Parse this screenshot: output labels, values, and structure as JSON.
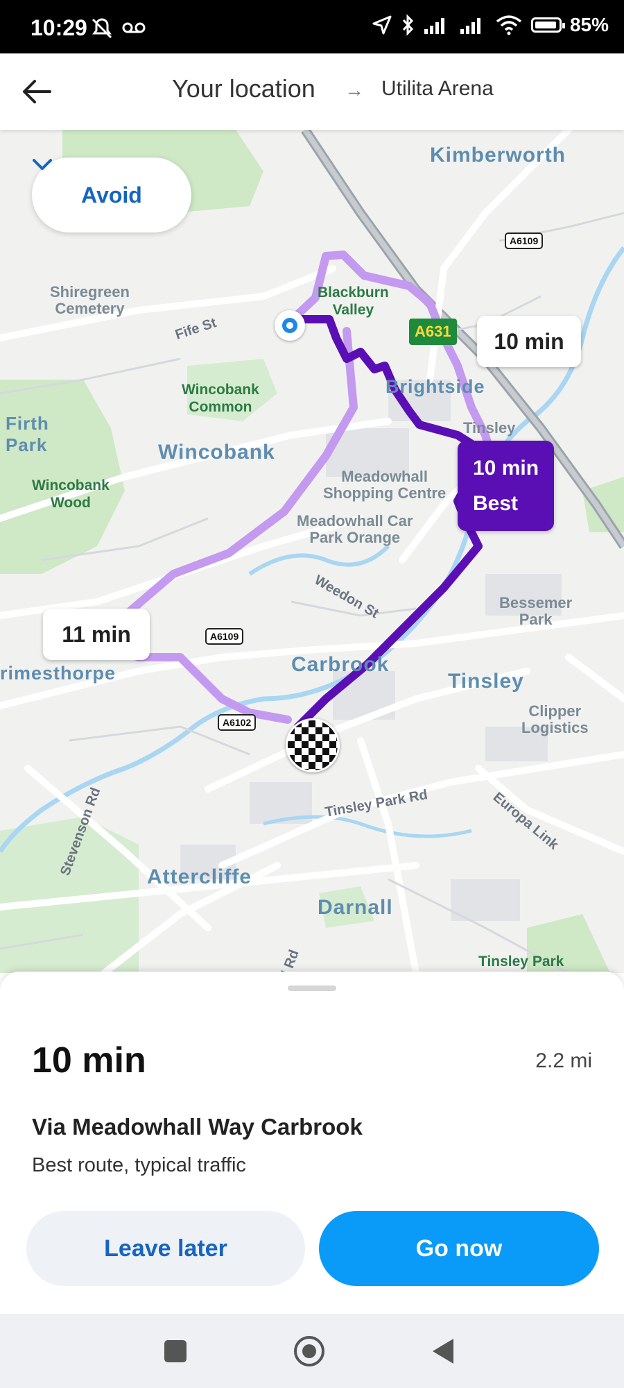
{
  "status_bar": {
    "time": "10:29",
    "battery": "85%",
    "battery_level": 0.85
  },
  "header": {
    "from": "Your location",
    "arrow": "→",
    "to": "Utilita Arena"
  },
  "map": {
    "avoid_label": "Avoid",
    "labels": {
      "kimberworth": "Kimberworth",
      "shiregreen": "Shiregreen\nCemetery",
      "blackburn": "Blackburn\nValley",
      "fife": "Fife St",
      "brightside": "Brightside",
      "wincobank_common": "Wincobank\nCommon",
      "firth_park": "Firth\nPark",
      "wincobank": "Wincobank",
      "wincobank_wood": "Wincobank\nWood",
      "meadowhall": "Meadowhall\nShopping Centre",
      "meadowhall_car": "Meadowhall Car\nPark Orange",
      "tinsley_small": "Tinsley",
      "weedon": "Weedon St",
      "bessemer": "Bessemer\nPark",
      "brimesthorpe": "rimesthorpe",
      "carbrook": "Carbrook",
      "tinsley": "Tinsley",
      "clipper": "Clipper\nLogistics",
      "tinsley_park_rd": "Tinsley Park Rd",
      "europa": "Europa Link",
      "stevenson": "Stevenson Rd",
      "attercliffe": "Attercliffe",
      "darnall": "Darnall",
      "tinsley_park": "Tinsley Park",
      "rd": "d Rd"
    },
    "shields": {
      "a6109_top": "A6109",
      "a631": "A631",
      "a6109_mid": "A6109",
      "a6102": "A6102"
    },
    "routes": {
      "alt_east": "10 min",
      "best_time": "10 min",
      "best_tag": "Best",
      "alt_west": "11 min"
    }
  },
  "summary": {
    "eta": "10 min",
    "distance": "2.2 mi",
    "via": "Via Meadowhall Way Carbrook",
    "description": "Best route, typical traffic",
    "leave_later": "Leave later",
    "go_now": "Go now"
  },
  "colors": {
    "best_route": "#5a0fb5",
    "alt_route": "#c39af0",
    "accent": "#0a9af7",
    "link": "#1565c0"
  }
}
